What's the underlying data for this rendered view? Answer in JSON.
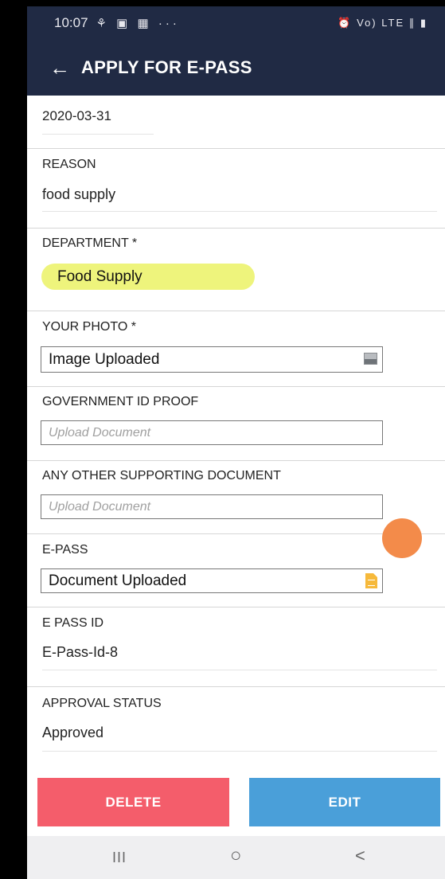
{
  "status_bar": {
    "time": "10:07",
    "notification_icons": "⚘ ▣ ▦ ···",
    "right_icons": "⏰ Vo) LTE ∥ ▮"
  },
  "app_bar": {
    "back_icon": "←",
    "title": "APPLY FOR E-PASS"
  },
  "form": {
    "date_value": "2020-03-31",
    "reason": {
      "label": "REASON",
      "value": "food supply"
    },
    "department": {
      "label": "DEPARTMENT *",
      "value": "Food Supply"
    },
    "photo": {
      "label": "YOUR PHOTO  *",
      "value": "Image Uploaded",
      "icon": "image-icon"
    },
    "gov_id": {
      "label": "GOVERNMENT ID PROOF",
      "placeholder": "Upload Document"
    },
    "other_doc": {
      "label": "ANY OTHER SUPPORTING DOCUMENT",
      "placeholder": "Upload Document"
    },
    "epass": {
      "label": "E-PASS",
      "value": "Document Uploaded",
      "icon": "document-icon"
    },
    "epass_id": {
      "label": "E PASS ID",
      "value": "E-Pass-Id-8"
    },
    "approval": {
      "label": "APPROVAL STATUS",
      "value": "Approved"
    }
  },
  "buttons": {
    "delete_label": "DELETE",
    "edit_label": "EDIT"
  },
  "nav_bar": {
    "recents": "III",
    "home": "○",
    "back": "<"
  },
  "colors": {
    "app_bar": "#202a44",
    "department_pill": "#eef47c",
    "delete_button": "#f45d6b",
    "edit_button": "#4a9fd9",
    "fab": "#f38b4a"
  }
}
